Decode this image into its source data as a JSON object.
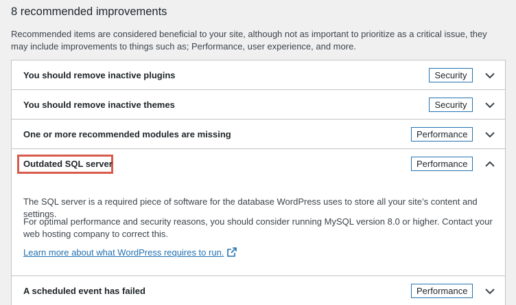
{
  "section": {
    "heading": "8 recommended improvements",
    "description": "Recommended items are considered beneficial to your site, although not as important to prioritize as a critical issue, they may include improvements to things such as; Performance, user experience, and more."
  },
  "items": [
    {
      "title": "You should remove inactive plugins",
      "badge": "Security",
      "expanded": false
    },
    {
      "title": "You should remove inactive themes",
      "badge": "Security",
      "expanded": false
    },
    {
      "title": "One or more recommended modules are missing",
      "badge": "Performance",
      "expanded": false
    },
    {
      "title": "Outdated SQL server",
      "badge": "Performance",
      "expanded": true
    },
    {
      "title": "A scheduled event has failed",
      "badge": "Performance",
      "expanded": false
    }
  ],
  "expanded_panel": {
    "paragraph_1": "The SQL server is a required piece of software for the database WordPress uses to store all your site’s content and settings.",
    "paragraph_2": "For optimal performance and security reasons, you should consider running MySQL version 8.0 or higher. Contact your web hosting company to correct this.",
    "link_text": "Learn more about what WordPress requires to run."
  },
  "colors": {
    "accent": "#2271b1",
    "highlight": "#d75a4a",
    "background": "#f0f0f1"
  },
  "icons": {
    "collapsed": "chevron-down-icon",
    "expanded": "chevron-up-icon",
    "external": "external-link-icon"
  }
}
